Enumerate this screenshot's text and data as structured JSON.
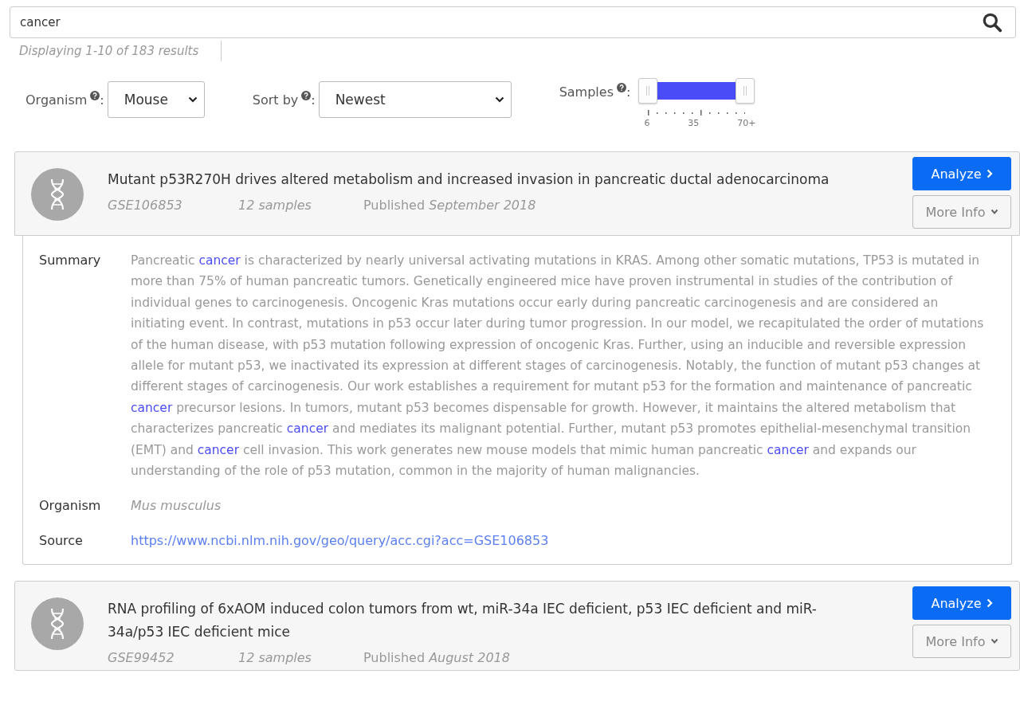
{
  "search": {
    "value": "cancer"
  },
  "results_count": "Displaying 1-10 of 183 results",
  "filters": {
    "organism": {
      "label": "Organism",
      "colon": ":",
      "value": "Mouse"
    },
    "sort": {
      "label": "Sort by",
      "colon": ":",
      "value": "Newest"
    },
    "samples": {
      "label": "Samples",
      "colon": ":",
      "level": 1,
      "ticks": [
        "6",
        "35",
        "70+"
      ]
    }
  },
  "results": [
    {
      "title": "Mutant p53R270H drives altered metabolism and increased invasion in pancreatic ductal adenocarcinoma",
      "accession": "GSE106853",
      "samples": "12 samples",
      "published_label": "Published",
      "published_date": "September 2018",
      "analyze": "Analyze",
      "more_info": "More Info",
      "expanded": true,
      "details": {
        "summary_label": "Summary",
        "summary": [
          {
            "text": "Pancreatic ",
            "highlight": false
          },
          {
            "text": "cancer",
            "highlight": true
          },
          {
            "text": " is characterized by nearly universal activating mutations in KRAS. Among other somatic mutations, TP53 is mutated in more than 75% of human pancreatic tumors. Genetically engineered mice have proven instrumental in studies of the contribution of individual genes to carcinogenesis. Oncogenic Kras mutations occur early during pancreatic carcinogenesis and are considered an initiating event. In contrast, mutations in p53 occur later during tumor progression. In our model, we recapitulated the order of mutations of the human disease, with p53 mutation following expression of oncogenic Kras. Further, using an inducible and reversible expression allele for mutant p53, we inactivated its expression at different stages of carcinogenesis. Notably, the function of mutant p53 changes at different stages of carcinogenesis. Our work establishes a requirement for mutant p53 for the formation and maintenance of pancreatic ",
            "highlight": false
          },
          {
            "text": "cancer",
            "highlight": true
          },
          {
            "text": " precursor lesions. In tumors, mutant p53 becomes dispensable for growth. However, it maintains the altered metabolism that characterizes pancreatic ",
            "highlight": false
          },
          {
            "text": "cancer",
            "highlight": true
          },
          {
            "text": " and mediates its malignant potential. Further, mutant p53 promotes epithelial-mesenchymal transition (EMT) and ",
            "highlight": false
          },
          {
            "text": "cancer",
            "highlight": true
          },
          {
            "text": " cell invasion. This work generates new mouse models that mimic human pancreatic ",
            "highlight": false
          },
          {
            "text": "cancer",
            "highlight": true
          },
          {
            "text": " and expands our understanding of the role of p53 mutation, common in the majority of human malignancies.",
            "highlight": false
          }
        ],
        "organism_label": "Organism",
        "organism": "Mus musculus",
        "source_label": "Source",
        "source": "https://www.ncbi.nlm.nih.gov/geo/query/acc.cgi?acc=GSE106853"
      }
    },
    {
      "title": "RNA profiling of 6xAOM induced colon tumors from wt, miR-34a IEC deficient, p53 IEC deficient and miR-34a/p53 IEC deficient mice",
      "accession": "GSE99452",
      "samples": "12 samples",
      "published_label": "Published",
      "published_date": "August 2018",
      "analyze": "Analyze",
      "more_info": "More Info",
      "expanded": false
    }
  ]
}
